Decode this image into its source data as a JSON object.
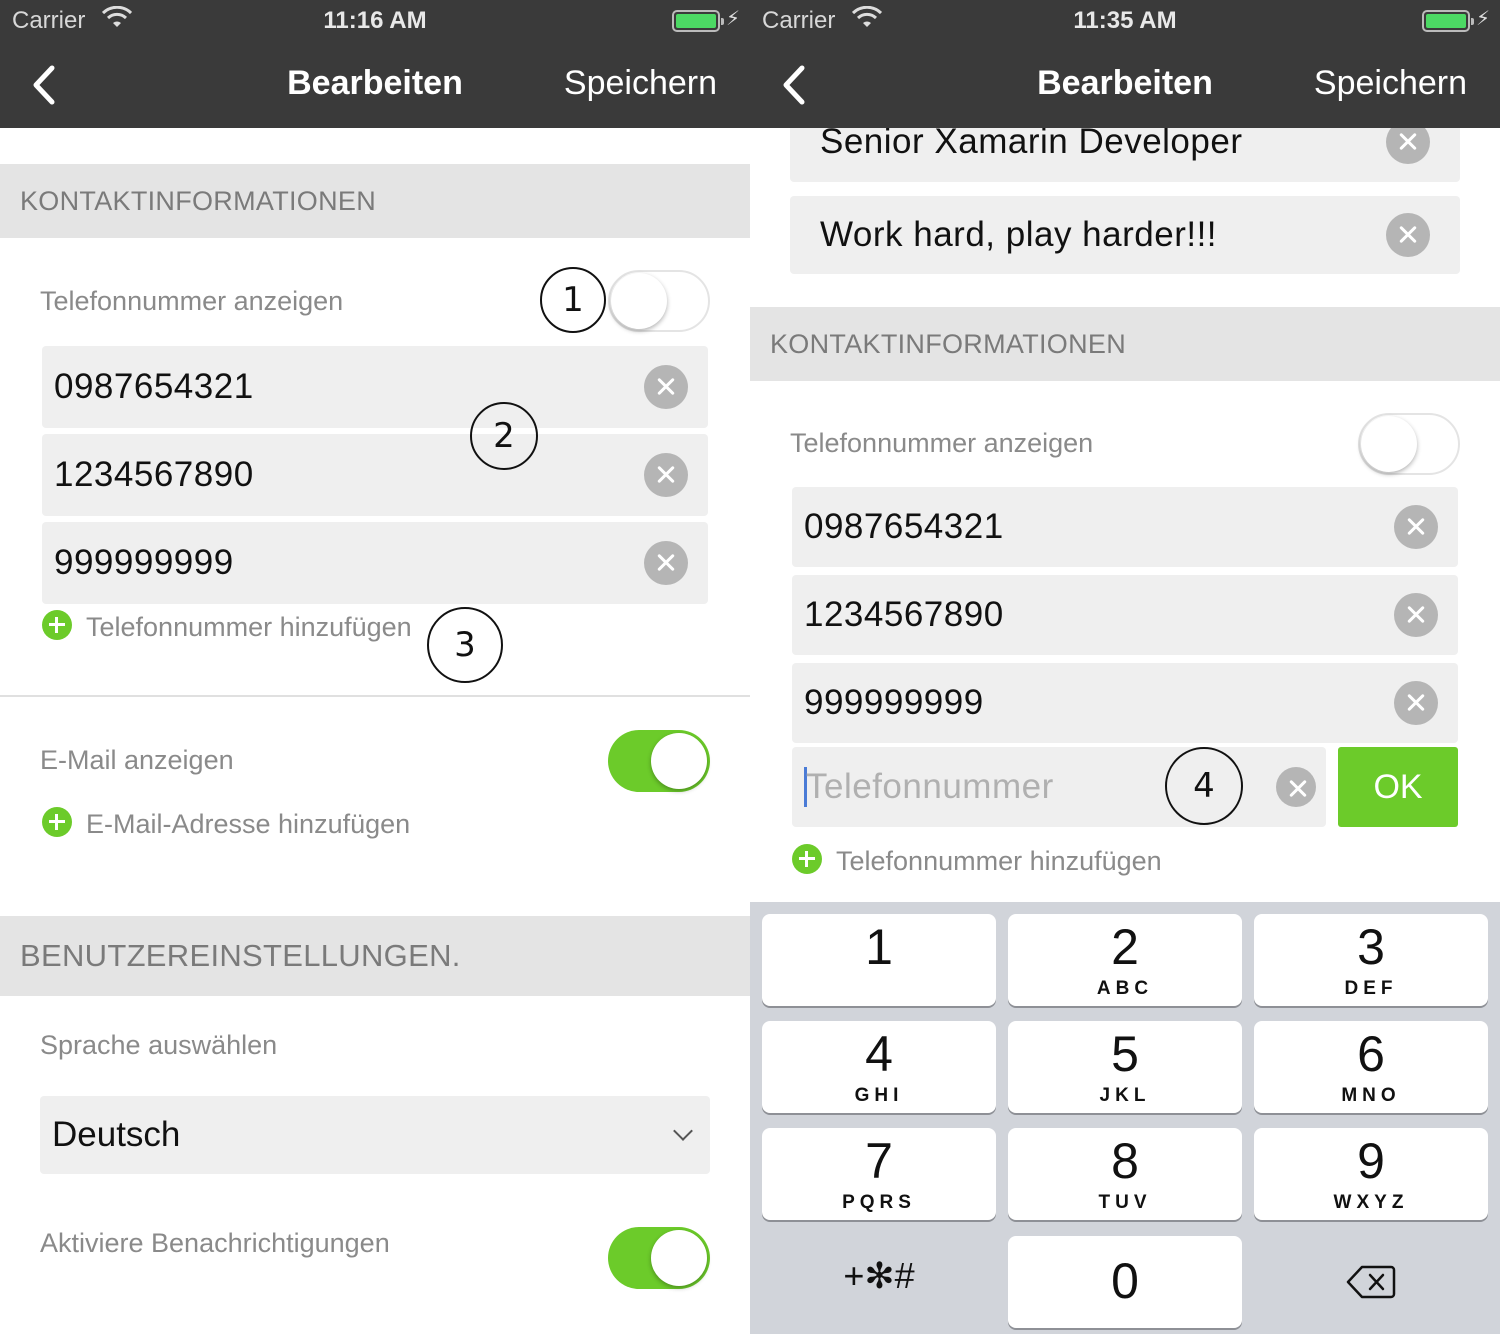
{
  "left": {
    "status": {
      "carrier": "Carrier",
      "time": "11:16 AM"
    },
    "nav": {
      "title": "Bearbeiten",
      "save": "Speichern"
    },
    "contact": {
      "header": "KONTAKTINFORMATIONEN",
      "show_phone_label": "Telefonnummer anzeigen",
      "show_phone_on": false,
      "phones": [
        "0987654321",
        "1234567890",
        "999999999"
      ],
      "add_phone": "Telefonnummer hinzufügen",
      "show_email_label": "E-Mail anzeigen",
      "show_email_on": true,
      "add_email": "E-Mail-Adresse hinzufügen"
    },
    "settings": {
      "header": "BENUTZEREINSTELLUNGEN.",
      "language_label": "Sprache auswählen",
      "language_value": "Deutsch",
      "notifications_label": "Aktiviere Benachrichtigungen",
      "notifications_on": true
    },
    "callouts": [
      "1",
      "2",
      "3"
    ]
  },
  "right": {
    "status": {
      "carrier": "Carrier",
      "time": "11:35 AM"
    },
    "nav": {
      "title": "Bearbeiten",
      "save": "Speichern"
    },
    "profile": {
      "job": "Senior Xamarin Developer",
      "motto": "Work hard, play harder!!!"
    },
    "contact": {
      "header": "KONTAKTINFORMATIONEN",
      "show_phone_label": "Telefonnummer anzeigen",
      "show_phone_on": false,
      "phones": [
        "0987654321",
        "1234567890",
        "999999999"
      ],
      "new_phone_placeholder": "Telefonnummer",
      "ok": "OK",
      "add_phone": "Telefonnummer hinzufügen"
    },
    "callouts": [
      "4"
    ],
    "keypad": [
      {
        "num": "1",
        "letters": ""
      },
      {
        "num": "2",
        "letters": "ABC"
      },
      {
        "num": "3",
        "letters": "DEF"
      },
      {
        "num": "4",
        "letters": "GHI"
      },
      {
        "num": "5",
        "letters": "JKL"
      },
      {
        "num": "6",
        "letters": "MNO"
      },
      {
        "num": "7",
        "letters": "PQRS"
      },
      {
        "num": "8",
        "letters": "TUV"
      },
      {
        "num": "9",
        "letters": "WXYZ"
      },
      {
        "num": "+✻#",
        "letters": ""
      },
      {
        "num": "0",
        "letters": ""
      }
    ]
  },
  "colors": {
    "accent": "#6ccb2a",
    "bar": "#3a3a3a",
    "section": "#e4e4e4",
    "field": "#efefef"
  },
  "icons": [
    "wifi-icon",
    "battery-icon",
    "charging-icon",
    "back-chevron-icon",
    "clear-icon",
    "add-icon",
    "chevron-down-icon",
    "backspace-icon"
  ]
}
